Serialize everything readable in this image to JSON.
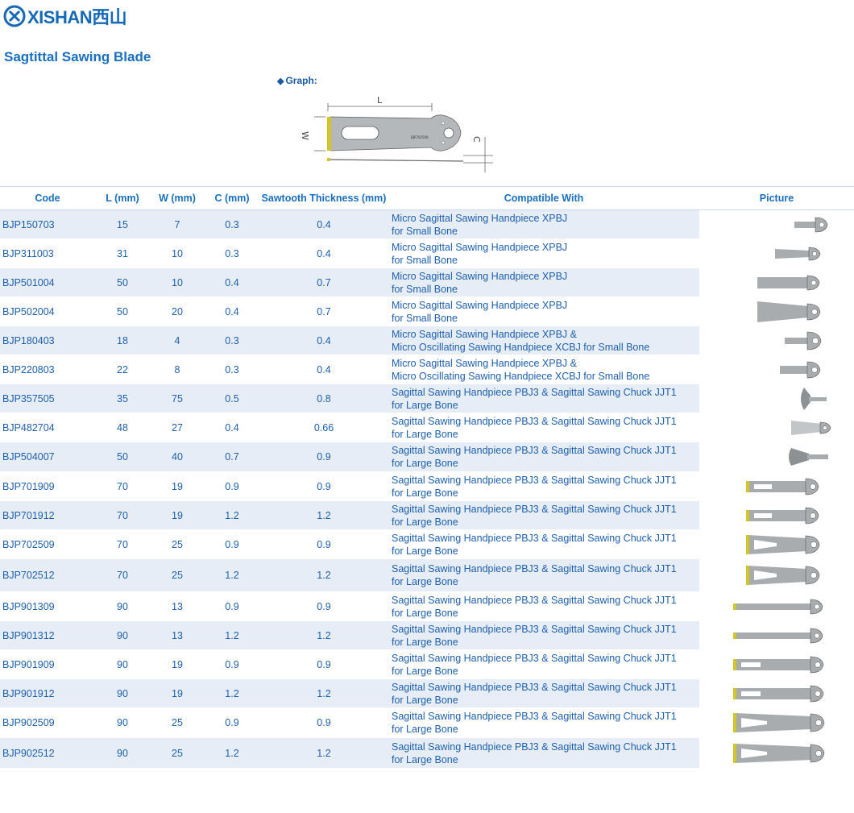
{
  "brand": {
    "name": "XISHAN",
    "name_cn": "西山"
  },
  "page_title": "Sagtittal Sawing Blade",
  "graph": {
    "label": "Graph:",
    "dim_l": "L",
    "dim_w": "W",
    "dim_c": "C",
    "blade_model": "BJP702509"
  },
  "table": {
    "headers": {
      "code": "Code",
      "l": "L (mm)",
      "w": "W (mm)",
      "c": "C (mm)",
      "thickness": "Sawtooth Thickness (mm)",
      "compat": "Compatible With",
      "picture": "Picture"
    },
    "rows": [
      {
        "code": "BJP150703",
        "l": "15",
        "w": "7",
        "c": "0.3",
        "t": "0.4",
        "compat1": "Micro Sagittal Sawing Handpiece XPBJ",
        "compat2": "for Small Bone"
      },
      {
        "code": "BJP311003",
        "l": "31",
        "w": "10",
        "c": "0.3",
        "t": "0.4",
        "compat1": "Micro Sagittal Sawing Handpiece XPBJ",
        "compat2": "for Small Bone"
      },
      {
        "code": "BJP501004",
        "l": "50",
        "w": "10",
        "c": "0.4",
        "t": "0.7",
        "compat1": "Micro Sagittal Sawing Handpiece XPBJ",
        "compat2": "for Small Bone"
      },
      {
        "code": "BJP502004",
        "l": "50",
        "w": "20",
        "c": "0.4",
        "t": "0.7",
        "compat1": "Micro Sagittal Sawing Handpiece XPBJ",
        "compat2": "for Small Bone"
      },
      {
        "code": "BJP180403",
        "l": "18",
        "w": "4",
        "c": "0.3",
        "t": "0.4",
        "compat1": "Micro Sagittal Sawing Handpiece XPBJ &",
        "compat2": "Micro Oscillating Sawing Handpiece XCBJ for Small Bone"
      },
      {
        "code": "BJP220803",
        "l": "22",
        "w": "8",
        "c": "0.3",
        "t": "0.4",
        "compat1": "Micro Sagittal Sawing Handpiece XPBJ &",
        "compat2": "Micro Oscillating Sawing Handpiece XCBJ for Small Bone"
      },
      {
        "code": "BJP357505",
        "l": "35",
        "w": "75",
        "c": "0.5",
        "t": "0.8",
        "compat1": "Sagittal Sawing Handpiece PBJ3 & Sagittal Sawing Chuck JJT1",
        "compat2": "for Large Bone"
      },
      {
        "code": "BJP482704",
        "l": "48",
        "w": "27",
        "c": "0.4",
        "t": "0.66",
        "compat1": "Sagittal Sawing Handpiece PBJ3 & Sagittal Sawing Chuck JJT1",
        "compat2": "for Large Bone"
      },
      {
        "code": "BJP504007",
        "l": "50",
        "w": "40",
        "c": "0.7",
        "t": "0.9",
        "compat1": "Sagittal Sawing Handpiece PBJ3 & Sagittal Sawing Chuck JJT1",
        "compat2": "for Large Bone"
      },
      {
        "code": "BJP701909",
        "l": "70",
        "w": "19",
        "c": "0.9",
        "t": "0.9",
        "compat1": "Sagittal Sawing Handpiece PBJ3 & Sagittal Sawing Chuck JJT1",
        "compat2": "for Large Bone"
      },
      {
        "code": "BJP701912",
        "l": "70",
        "w": "19",
        "c": "1.2",
        "t": "1.2",
        "compat1": "Sagittal Sawing Handpiece PBJ3 & Sagittal Sawing Chuck JJT1",
        "compat2": "for Large Bone"
      },
      {
        "code": "BJP702509",
        "l": "70",
        "w": "25",
        "c": "0.9",
        "t": "0.9",
        "compat1": "Sagittal Sawing Handpiece PBJ3 & Sagittal Sawing Chuck JJT1",
        "compat2": "for Large Bone"
      },
      {
        "code": "BJP702512",
        "l": "70",
        "w": "25",
        "c": "1.2",
        "t": "1.2",
        "compat1": "Sagittal Sawing Handpiece PBJ3 & Sagittal Sawing Chuck JJT1",
        "compat2": "for Large Bone"
      },
      {
        "code": "BJP901309",
        "l": "90",
        "w": "13",
        "c": "0.9",
        "t": "0.9",
        "compat1": "Sagittal Sawing Handpiece PBJ3 & Sagittal Sawing Chuck JJT1",
        "compat2": "for Large Bone"
      },
      {
        "code": "BJP901312",
        "l": "90",
        "w": "13",
        "c": "1.2",
        "t": "1.2",
        "compat1": "Sagittal Sawing Handpiece PBJ3 & Sagittal Sawing Chuck JJT1",
        "compat2": "for Large Bone"
      },
      {
        "code": "BJP901909",
        "l": "90",
        "w": "19",
        "c": "0.9",
        "t": "0.9",
        "compat1": "Sagittal Sawing Handpiece PBJ3 & Sagittal Sawing Chuck JJT1",
        "compat2": "for Large Bone"
      },
      {
        "code": "BJP901912",
        "l": "90",
        "w": "19",
        "c": "1.2",
        "t": "1.2",
        "compat1": "Sagittal Sawing Handpiece PBJ3 & Sagittal Sawing Chuck JJT1",
        "compat2": "for Large Bone"
      },
      {
        "code": "BJP902509",
        "l": "90",
        "w": "25",
        "c": "0.9",
        "t": "0.9",
        "compat1": "Sagittal Sawing Handpiece PBJ3 & Sagittal Sawing Chuck JJT1",
        "compat2": "for Large Bone"
      },
      {
        "code": "BJP902512",
        "l": "90",
        "w": "25",
        "c": "1.2",
        "t": "1.2",
        "compat1": "Sagittal Sawing Handpiece PBJ3 & Sagittal Sawing Chuck JJT1",
        "compat2": "for Large Bone"
      }
    ]
  },
  "colors": {
    "accent": "#1a6fc0",
    "row_shade": "#e6edf6",
    "blade_steel": "#a9acae",
    "blade_teeth": "#d2c52a"
  }
}
